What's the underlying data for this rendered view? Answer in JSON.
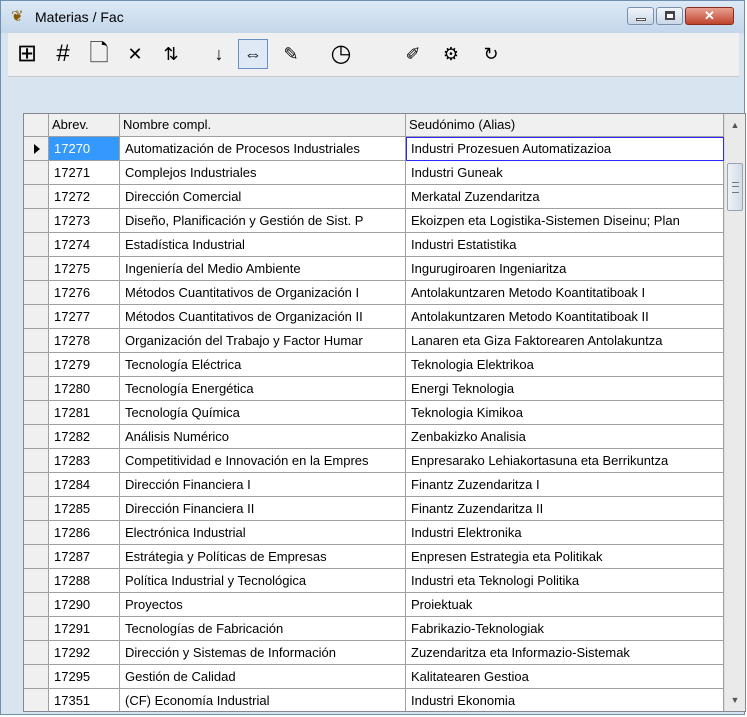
{
  "window": {
    "title": "Materias / Fac"
  },
  "titlebar_icons": {
    "app": "app-icon",
    "minimize": "minimize-icon",
    "maximize": "maximize-icon",
    "close": "close-icon"
  },
  "toolbar": {
    "tools": [
      {
        "name": "fit-grid-icon",
        "glyph": "⊞"
      },
      {
        "name": "grid-icon",
        "glyph": "#"
      },
      {
        "name": "new-document-icon",
        "glyph": "🗋"
      },
      {
        "name": "delete-icon",
        "glyph": "✕"
      },
      {
        "name": "replace-icon",
        "glyph": "⇅"
      },
      {
        "name": "sort-az-icon",
        "glyph": "↓"
      },
      {
        "name": "column-width-icon",
        "glyph": "⇔"
      },
      {
        "name": "tool-icon",
        "glyph": "✎"
      },
      {
        "name": "clock-icon",
        "glyph": "◷"
      },
      {
        "name": "palette-icon",
        "glyph": "✐"
      },
      {
        "name": "settings-icon",
        "glyph": "⚙"
      },
      {
        "name": "refresh-icon",
        "glyph": "↻"
      }
    ]
  },
  "table": {
    "headers": [
      "Abrev.",
      "Nombre compl.",
      "Seudónimo (Alias)"
    ],
    "selected_index": 0,
    "rows": [
      [
        "17270",
        "Automatización de Procesos Industriales",
        "Industri Prozesuen Automatizazioa"
      ],
      [
        "17271",
        "Complejos Industriales",
        "Industri Guneak"
      ],
      [
        "17272",
        "Dirección Comercial",
        "Merkatal Zuzendaritza"
      ],
      [
        "17273",
        "Diseño, Planificación y Gestión de Sist. P",
        "Ekoizpen eta Logistika-Sistemen Diseinu; Plan"
      ],
      [
        "17274",
        "Estadística Industrial",
        "Industri Estatistika"
      ],
      [
        "17275",
        "Ingeniería del Medio Ambiente",
        "Ingurugiroaren Ingeniaritza"
      ],
      [
        "17276",
        "Métodos Cuantitativos de Organización I",
        "Antolakuntzaren Metodo Koantitatiboak I"
      ],
      [
        "17277",
        "Métodos Cuantitativos de Organización II",
        "Antolakuntzaren Metodo Koantitatiboak II"
      ],
      [
        "17278",
        "Organización del Trabajo y Factor Humar",
        "Lanaren eta Giza Faktorearen Antolakuntza"
      ],
      [
        "17279",
        "Tecnología Eléctrica",
        "Teknologia Elektrikoa"
      ],
      [
        "17280",
        "Tecnología Energética",
        "Energi Teknologia"
      ],
      [
        "17281",
        "Tecnología Química",
        "Teknologia Kimikoa"
      ],
      [
        "17282",
        "Análisis Numérico",
        "Zenbakizko Analisia"
      ],
      [
        "17283",
        "Competitividad e Innovación en la Empres",
        "Enpresarako Lehiakortasuna eta Berrikuntza"
      ],
      [
        "17284",
        "Dirección Financiera I",
        "Finantz Zuzendaritza I"
      ],
      [
        "17285",
        "Dirección Financiera II",
        "Finantz Zuzendaritza II"
      ],
      [
        "17286",
        "Electrónica Industrial",
        "Industri Elektronika"
      ],
      [
        "17287",
        "Estrátegia y Políticas de Empresas",
        "Enpresen Estrategia eta Politikak"
      ],
      [
        "17288",
        "Política Industrial y Tecnológica",
        "Industri eta Teknologi Politika"
      ],
      [
        "17290",
        "Proyectos",
        "Proiektuak"
      ],
      [
        "17291",
        "Tecnologías de Fabricación",
        "Fabrikazio-Teknologiak"
      ],
      [
        "17292",
        "Dirección y Sistemas de Información",
        "Zuzendaritza eta Informazio-Sistemak"
      ],
      [
        "17295",
        "Gestión de Calidad",
        "Kalitatearen Gestioa"
      ],
      [
        "17351",
        "(CF) Economía Industrial",
        "Industri Ekonomia"
      ]
    ]
  },
  "scrollbar": {
    "up": "▲",
    "down": "▼"
  }
}
